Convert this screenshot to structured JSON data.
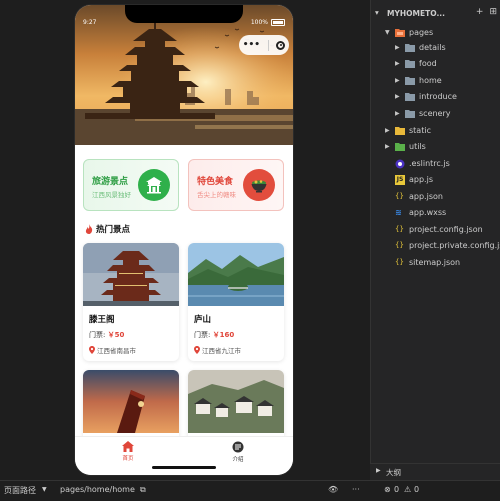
{
  "simulator": {
    "status_time": "9:27",
    "status_battery": "100%",
    "capsule_dots": "•••",
    "categories": [
      {
        "title": "旅游景点",
        "subtitle": "江西风景独好",
        "icon": "pavilion-icon"
      },
      {
        "title": "特色美食",
        "subtitle": "舌尖上的赣味",
        "icon": "food-bowl-icon"
      }
    ],
    "section_title": "热门景点",
    "price_prefix": "门票:",
    "spots": [
      {
        "name": "滕王阁",
        "price": "￥50",
        "location": "江西省南昌市"
      },
      {
        "name": "庐山",
        "price": "￥160",
        "location": "江西省九江市"
      }
    ],
    "tabs": [
      {
        "label": "首页",
        "active": true,
        "icon": "home-icon"
      },
      {
        "label": "介绍",
        "active": false,
        "icon": "info-icon"
      }
    ]
  },
  "explorer": {
    "root": "MYHOMETO...",
    "items": [
      {
        "name": "pages",
        "type": "folder",
        "expanded": true
      },
      {
        "name": "details",
        "type": "folder"
      },
      {
        "name": "food",
        "type": "folder"
      },
      {
        "name": "home",
        "type": "folder"
      },
      {
        "name": "introduce",
        "type": "folder"
      },
      {
        "name": "scenery",
        "type": "folder"
      },
      {
        "name": "static",
        "type": "folder"
      },
      {
        "name": "utils",
        "type": "folder"
      },
      {
        "name": ".eslintrc.js",
        "type": "eslint"
      },
      {
        "name": "app.js",
        "type": "js"
      },
      {
        "name": "app.json",
        "type": "json"
      },
      {
        "name": "app.wxss",
        "type": "wxss"
      },
      {
        "name": "project.config.json",
        "type": "json"
      },
      {
        "name": "project.private.config.js",
        "type": "json"
      },
      {
        "name": "sitemap.json",
        "type": "json"
      }
    ],
    "outline_label": "大纲"
  },
  "statusbar": {
    "path_label": "页面路径",
    "path_value": "pages/home/home",
    "errors": "0",
    "warnings": "0",
    "more": "···"
  },
  "colors": {
    "accent_red": "#e0463a",
    "accent_green": "#2fb04b",
    "editor_bg": "#1e1e1e",
    "sidebar_bg": "#252526"
  }
}
